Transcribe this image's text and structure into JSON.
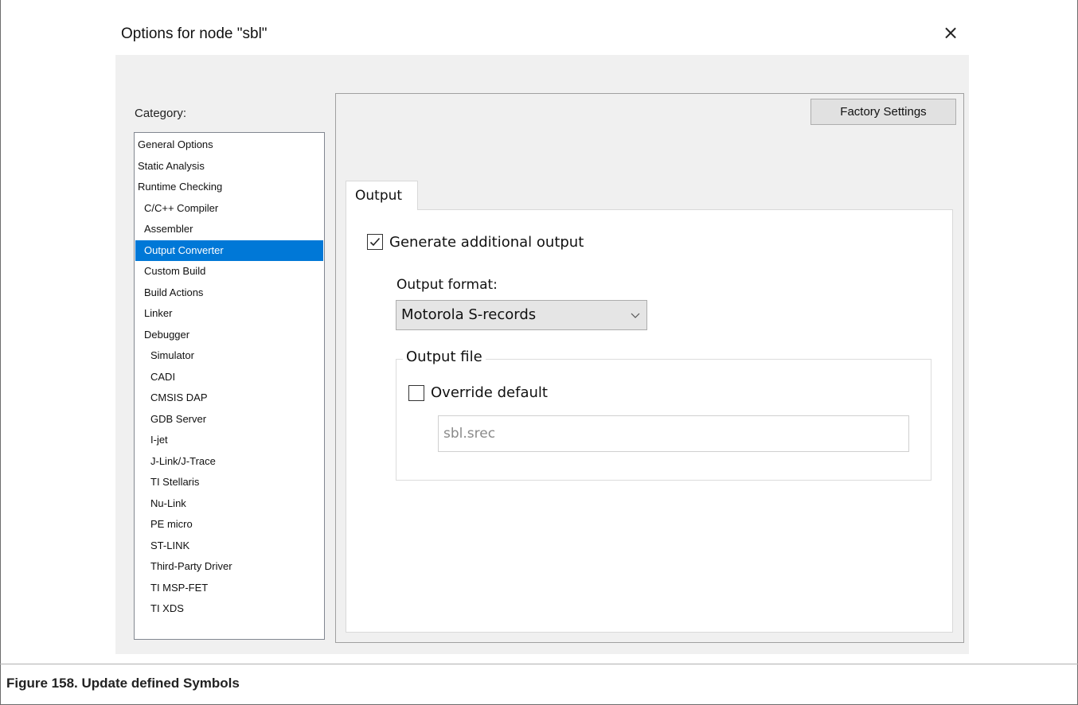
{
  "dialog": {
    "title": "Options for node \"sbl\"",
    "close_glyph": "×"
  },
  "category": {
    "label": "Category:",
    "items": [
      {
        "label": "General Options",
        "indent": 0,
        "selected": false
      },
      {
        "label": "Static Analysis",
        "indent": 0,
        "selected": false
      },
      {
        "label": "Runtime Checking",
        "indent": 0,
        "selected": false
      },
      {
        "label": "C/C++ Compiler",
        "indent": 1,
        "selected": false
      },
      {
        "label": "Assembler",
        "indent": 1,
        "selected": false
      },
      {
        "label": "Output Converter",
        "indent": 1,
        "selected": true
      },
      {
        "label": "Custom Build",
        "indent": 1,
        "selected": false
      },
      {
        "label": "Build Actions",
        "indent": 1,
        "selected": false
      },
      {
        "label": "Linker",
        "indent": 1,
        "selected": false
      },
      {
        "label": "Debugger",
        "indent": 1,
        "selected": false
      },
      {
        "label": "Simulator",
        "indent": 2,
        "selected": false
      },
      {
        "label": "CADI",
        "indent": 2,
        "selected": false
      },
      {
        "label": "CMSIS DAP",
        "indent": 2,
        "selected": false
      },
      {
        "label": "GDB Server",
        "indent": 2,
        "selected": false
      },
      {
        "label": "I-jet",
        "indent": 2,
        "selected": false
      },
      {
        "label": "J-Link/J-Trace",
        "indent": 2,
        "selected": false
      },
      {
        "label": "TI Stellaris",
        "indent": 2,
        "selected": false
      },
      {
        "label": "Nu-Link",
        "indent": 2,
        "selected": false
      },
      {
        "label": "PE micro",
        "indent": 2,
        "selected": false
      },
      {
        "label": "ST-LINK",
        "indent": 2,
        "selected": false
      },
      {
        "label": "Third-Party Driver",
        "indent": 2,
        "selected": false
      },
      {
        "label": "TI MSP-FET",
        "indent": 2,
        "selected": false
      },
      {
        "label": "TI XDS",
        "indent": 2,
        "selected": false
      }
    ]
  },
  "panel": {
    "factory_button": "Factory Settings",
    "tab_label": "Output",
    "generate": {
      "label": "Generate additional output",
      "checked": true
    },
    "format": {
      "label": "Output format:",
      "value": "Motorola S-records"
    },
    "output_file": {
      "group_title": "Output file",
      "override": {
        "label": "Override default",
        "checked": false
      },
      "path": "sbl.srec"
    }
  },
  "caption": "Figure 158. Update defined Symbols",
  "colors": {
    "selection": "#0078d7",
    "dialog_bg": "#f0f0f0"
  }
}
